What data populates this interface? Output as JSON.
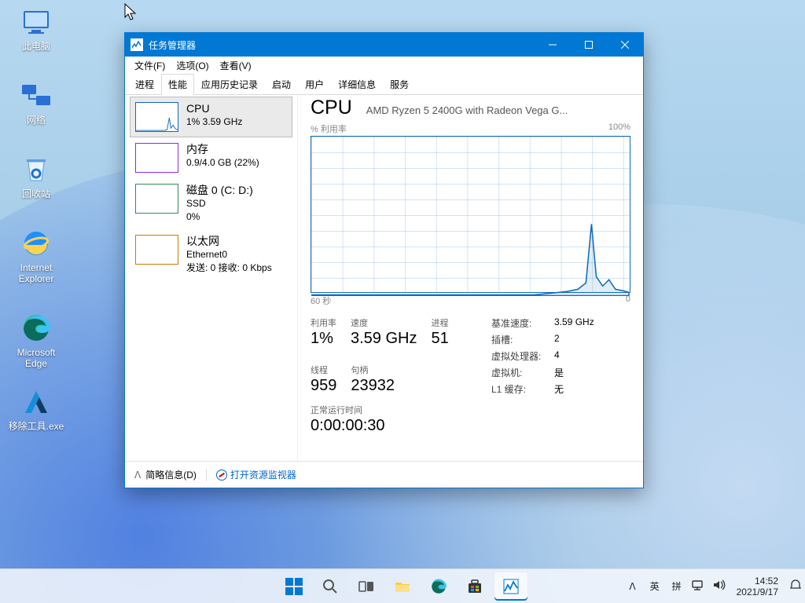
{
  "desktop": {
    "icons": [
      {
        "label": "此电脑"
      },
      {
        "label": "网络"
      },
      {
        "label": "回收站"
      },
      {
        "label": "Internet Explorer"
      },
      {
        "label": "Microsoft Edge"
      },
      {
        "label": "移除工具.exe"
      }
    ]
  },
  "window": {
    "title": "任务管理器",
    "menu": {
      "file": "文件(F)",
      "options": "选项(O)",
      "view": "查看(V)"
    },
    "tabs": [
      "进程",
      "性能",
      "应用历史记录",
      "启动",
      "用户",
      "详细信息",
      "服务"
    ],
    "active_tab": 1
  },
  "resources": [
    {
      "name": "CPU",
      "sub": "1% 3.59 GHz",
      "border": "#0f6bbf"
    },
    {
      "name": "内存",
      "sub": "0.9/4.0 GB (22%)",
      "border": "#8a2be2"
    },
    {
      "name": "磁盘 0 (C: D:)",
      "sub": "SSD\n0%",
      "border": "#2e8b57"
    },
    {
      "name": "以太网",
      "sub": "Ethernet0\n发送: 0 接收: 0 Kbps",
      "border": "#cc7a00"
    }
  ],
  "cpu": {
    "heading": "CPU",
    "model": "AMD Ryzen 5 2400G with Radeon Vega G...",
    "util_label": "% 利用率",
    "util_max": "100%",
    "x_left": "60 秒",
    "x_right": "0",
    "stats": {
      "util": {
        "label": "利用率",
        "value": "1%"
      },
      "speed": {
        "label": "速度",
        "value": "3.59 GHz"
      },
      "procs": {
        "label": "进程",
        "value": "51"
      },
      "threads": {
        "label": "线程",
        "value": "959"
      },
      "handles": {
        "label": "句柄",
        "value": "23932"
      }
    },
    "kv": {
      "base": {
        "k": "基准速度:",
        "v": "3.59 GHz"
      },
      "sockets": {
        "k": "插槽:",
        "v": "2"
      },
      "logical": {
        "k": "虚拟处理器:",
        "v": "4"
      },
      "vm": {
        "k": "虚拟机:",
        "v": "是"
      },
      "l1": {
        "k": "L1 缓存:",
        "v": "无"
      }
    },
    "uptime": {
      "label": "正常运行时间",
      "value": "0:00:00:30"
    }
  },
  "chart_data": {
    "type": "line",
    "title": "% 利用率",
    "xlabel": "秒",
    "ylabel": "% 利用率",
    "xlim": [
      60,
      0
    ],
    "ylim": [
      0,
      100
    ],
    "x": [
      60,
      55,
      50,
      45,
      40,
      35,
      30,
      25,
      20,
      15,
      12,
      10,
      8,
      7,
      6,
      5,
      4,
      3,
      2,
      1,
      0
    ],
    "values": [
      0,
      0,
      0,
      0,
      0,
      0,
      0,
      0,
      0,
      0,
      0,
      2,
      4,
      8,
      45,
      12,
      6,
      10,
      4,
      3,
      2
    ]
  },
  "footer": {
    "brief": "简略信息(D)",
    "resmon": "打开资源监视器"
  },
  "tray": {
    "ime1": "英",
    "ime2": "拼",
    "time": "14:52",
    "date": "2021/9/17"
  }
}
